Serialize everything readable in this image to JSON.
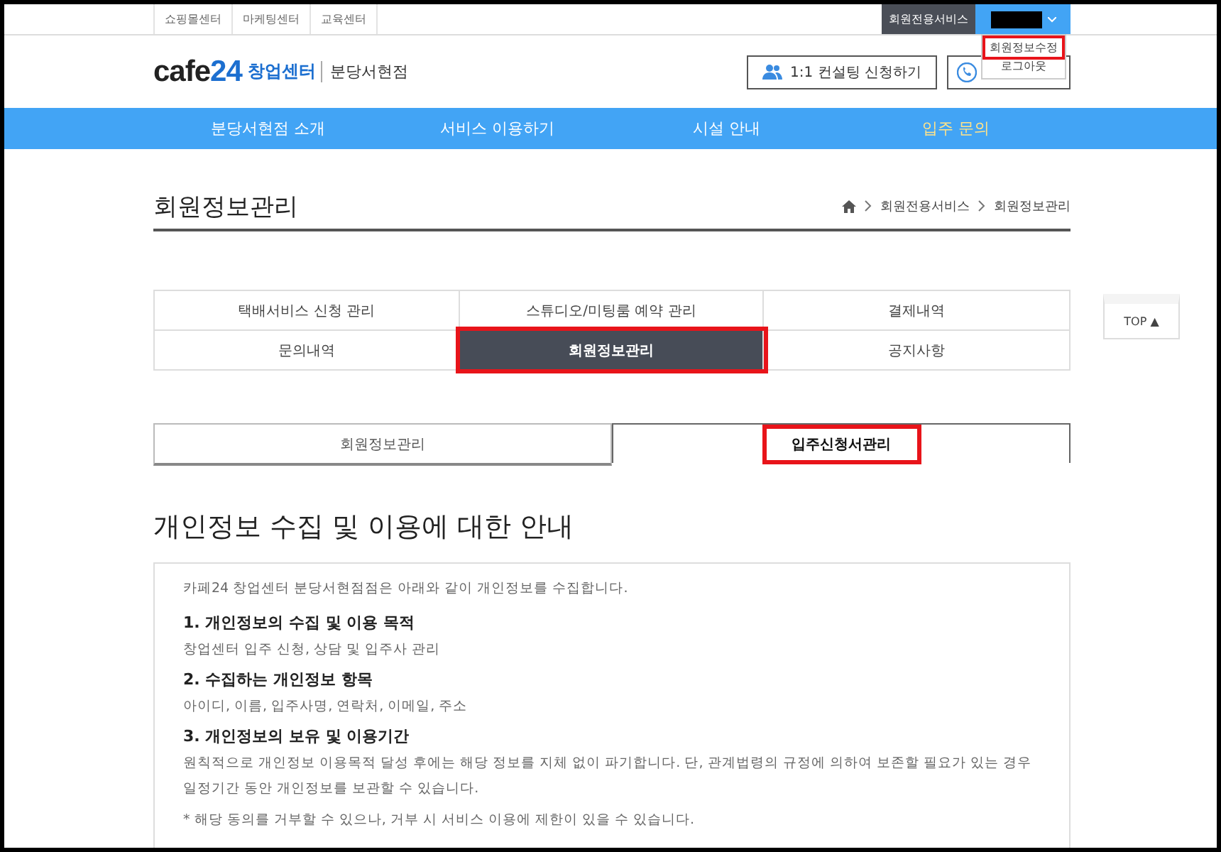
{
  "top_links": [
    "쇼핑몰센터",
    "마케팅센터",
    "교육센터"
  ],
  "member_menu": {
    "label": "회원전용서비스"
  },
  "user_dropdown": {
    "expanded": true,
    "items": [
      {
        "label": "회원정보수정",
        "highlighted": true
      },
      {
        "label": "로그아웃",
        "highlighted": false
      }
    ]
  },
  "logo": {
    "brand_main": "cafe",
    "brand_number": "24",
    "center": "창업센터",
    "branch": "분당서현점"
  },
  "header_buttons": [
    {
      "kind": "consult",
      "label": "1:1 컨설팅 신청하기"
    },
    {
      "kind": "phone"
    }
  ],
  "nav": [
    {
      "label": "분당서현점 소개",
      "selected": false
    },
    {
      "label": "서비스 이용하기",
      "selected": false
    },
    {
      "label": "시설 안내",
      "selected": false
    },
    {
      "label": "입주 문의",
      "selected": true
    }
  ],
  "page_title": "회원정보관리",
  "breadcrumb": [
    "회원전용서비스",
    "회원정보관리"
  ],
  "service_menu": [
    {
      "label": "택배서비스 신청 관리",
      "selected": false,
      "highlighted": false
    },
    {
      "label": "스튜디오/미팅룸 예약 관리",
      "selected": false,
      "highlighted": false
    },
    {
      "label": "결제내역",
      "selected": false,
      "highlighted": false
    },
    {
      "label": "문의내역",
      "selected": false,
      "highlighted": false
    },
    {
      "label": "회원정보관리",
      "selected": true,
      "highlighted": true
    },
    {
      "label": "공지사항",
      "selected": false,
      "highlighted": false
    }
  ],
  "top_button": "TOP ▲",
  "tabs": [
    {
      "label": "회원정보관리",
      "selected": false,
      "highlighted": false
    },
    {
      "label": "입주신청서관리",
      "selected": true,
      "highlighted": true
    }
  ],
  "notice": {
    "heading": "개인정보 수집 및 이용에 대한 안내",
    "intro": "카페24 창업센터 분당서현점점은 아래와 같이 개인정보를 수집합니다.",
    "sections": [
      {
        "title": "1. 개인정보의 수집 및 이용 목적",
        "body": [
          "창업센터 입주 신청, 상담 및 입주사 관리"
        ]
      },
      {
        "title": "2. 수집하는 개인정보 항목",
        "body": [
          "아이디, 이름, 입주사명, 연락처, 이메일, 주소"
        ]
      },
      {
        "title": "3. 개인정보의 보유 및 이용기간",
        "body": [
          "원칙적으로 개인정보 이용목적 달성 후에는 해당 정보를 지체 없이 파기합니다. 단, 관계법령의 규정에 의하여 보존할 필요가 있는 경우 일정기간 동안 개인정보를 보관할 수 있습니다.",
          "* 해당 동의를 거부할 수 있으나, 거부 시 서비스 이용에 제한이 있을 수 있습니다."
        ]
      }
    ]
  }
}
